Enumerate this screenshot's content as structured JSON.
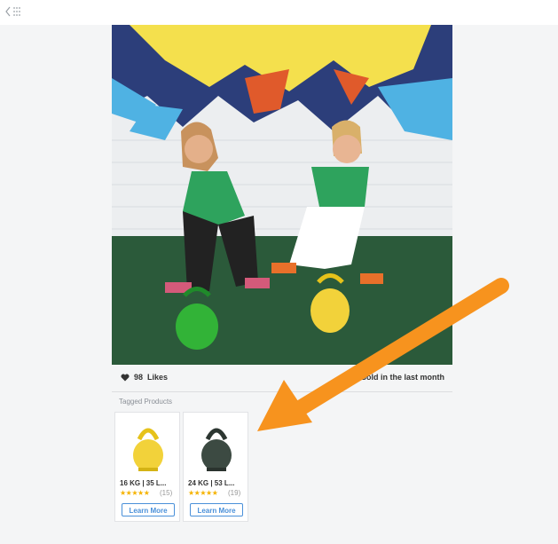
{
  "likes": {
    "count": "98",
    "label": "Likes"
  },
  "sold_text": "Sold in the last month",
  "tagged": {
    "title": "Tagged Products",
    "products": [
      {
        "name": "16 KG | 35 L...",
        "stars": "★★★★★",
        "count": "(15)",
        "learn": "Learn More",
        "color": "#f2d23a"
      },
      {
        "name": "24 KG | 53 L...",
        "stars": "★★★★★",
        "count": "(19)",
        "learn": "Learn More",
        "color": "#3c4a42"
      }
    ]
  },
  "colors": {
    "accent": "#4a90d9",
    "arrow": "#f7931e",
    "star": "#f5b301"
  },
  "icons": {
    "back": "chevron-left-icon",
    "grid": "grid-dots-icon",
    "like": "heart-icon"
  }
}
